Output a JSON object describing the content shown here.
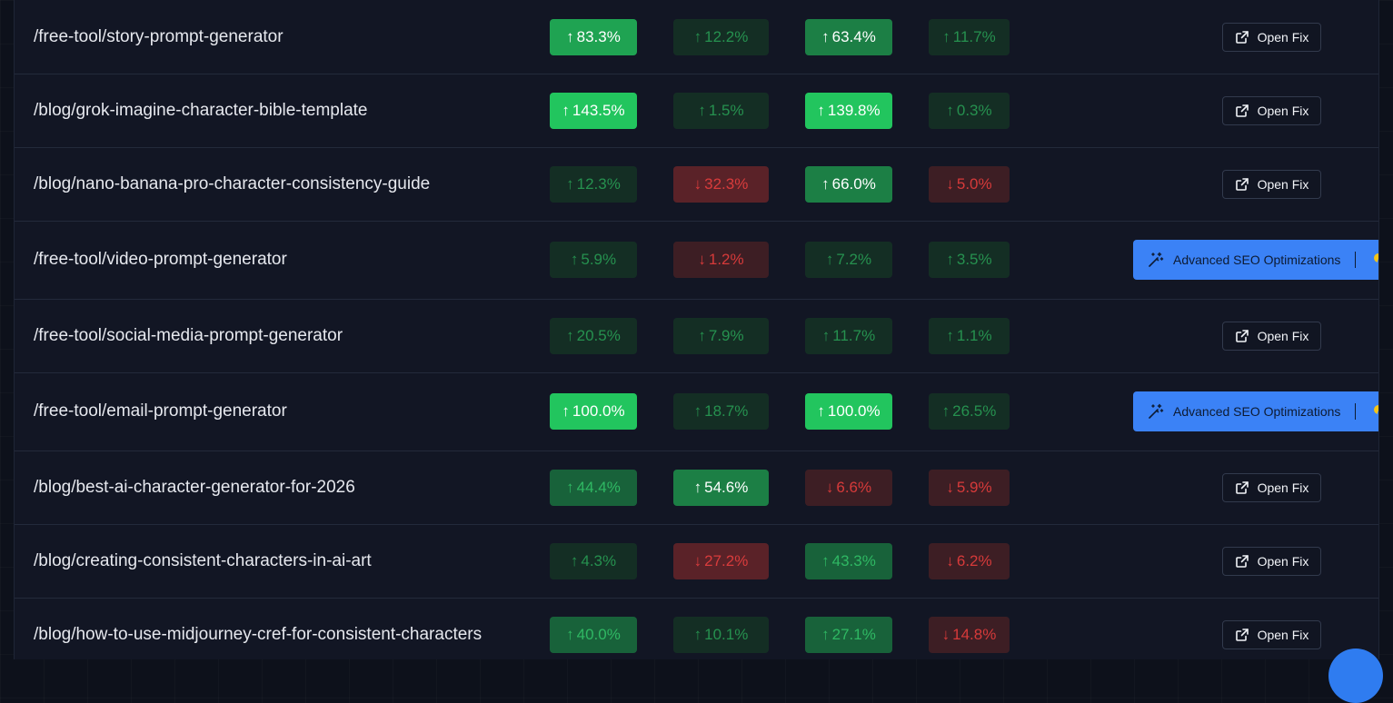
{
  "rows": [
    {
      "path": "/free-tool/story-prompt-generator",
      "cells": [
        {
          "value": "83.3%",
          "arrow": "↑"
        },
        {
          "value": "12.2%",
          "arrow": "↑"
        },
        {
          "value": "63.4%",
          "arrow": "↑"
        },
        {
          "value": "11.7%",
          "arrow": "↑"
        }
      ],
      "action": "open_fix"
    },
    {
      "path": "/blog/grok-imagine-character-bible-template",
      "cells": [
        {
          "value": "143.5%",
          "arrow": "↑"
        },
        {
          "value": "1.5%",
          "arrow": "↑"
        },
        {
          "value": "139.8%",
          "arrow": "↑"
        },
        {
          "value": "0.3%",
          "arrow": "↑"
        }
      ],
      "action": "open_fix"
    },
    {
      "path": "/blog/nano-banana-pro-character-consistency-guide",
      "cells": [
        {
          "value": "12.3%",
          "arrow": "↑"
        },
        {
          "value": "32.3%",
          "arrow": "↓"
        },
        {
          "value": "66.0%",
          "arrow": "↑"
        },
        {
          "value": "5.0%",
          "arrow": "↓"
        }
      ],
      "action": "open_fix"
    },
    {
      "path": "/free-tool/video-prompt-generator",
      "cells": [
        {
          "value": "5.9%",
          "arrow": "↑"
        },
        {
          "value": "1.2%",
          "arrow": "↓"
        },
        {
          "value": "7.2%",
          "arrow": "↑"
        },
        {
          "value": "3.5%",
          "arrow": "↑"
        }
      ],
      "action": "seo"
    },
    {
      "path": "/free-tool/social-media-prompt-generator",
      "cells": [
        {
          "value": "20.5%",
          "arrow": "↑"
        },
        {
          "value": "7.9%",
          "arrow": "↑"
        },
        {
          "value": "11.7%",
          "arrow": "↑"
        },
        {
          "value": "1.1%",
          "arrow": "↑"
        }
      ],
      "action": "open_fix"
    },
    {
      "path": "/free-tool/email-prompt-generator",
      "cells": [
        {
          "value": "100.0%",
          "arrow": "↑"
        },
        {
          "value": "18.7%",
          "arrow": "↑"
        },
        {
          "value": "100.0%",
          "arrow": "↑"
        },
        {
          "value": "26.5%",
          "arrow": "↑"
        }
      ],
      "action": "seo"
    },
    {
      "path": "/blog/best-ai-character-generator-for-2026",
      "cells": [
        {
          "value": "44.4%",
          "arrow": "↑"
        },
        {
          "value": "54.6%",
          "arrow": "↑"
        },
        {
          "value": "6.6%",
          "arrow": "↓"
        },
        {
          "value": "5.9%",
          "arrow": "↓"
        }
      ],
      "action": "open_fix"
    },
    {
      "path": "/blog/creating-consistent-characters-in-ai-art",
      "cells": [
        {
          "value": "4.3%",
          "arrow": "↑"
        },
        {
          "value": "27.2%",
          "arrow": "↓"
        },
        {
          "value": "43.3%",
          "arrow": "↑"
        },
        {
          "value": "6.2%",
          "arrow": "↓"
        }
      ],
      "action": "open_fix"
    },
    {
      "path": "/blog/how-to-use-midjourney-cref-for-consistent-characters",
      "cells": [
        {
          "value": "40.0%",
          "arrow": "↑"
        },
        {
          "value": "10.1%",
          "arrow": "↑"
        },
        {
          "value": "27.1%",
          "arrow": "↑"
        },
        {
          "value": "14.8%",
          "arrow": "↓"
        }
      ],
      "action": "open_fix"
    }
  ],
  "labels": {
    "open_fix": "Open Fix",
    "seo": "Advanced SEO Optimizations"
  },
  "colors": {
    "up_bright": "#22c55e",
    "up_strong": "#1fa352",
    "up_med": "#1c7f45",
    "up_mid": "#18623a",
    "up_soft": "#173f2c",
    "up_faint": "#142e24",
    "down_strong": "#5a2228",
    "down_soft": "#3d1e24",
    "seo_button": "#3b82f6",
    "panel": "#121624"
  },
  "icons": {
    "open_fix": "external-link-icon",
    "seo": "magic-wand-icon",
    "coins": "coins-icon",
    "chat": "chat-bubble-icon"
  }
}
